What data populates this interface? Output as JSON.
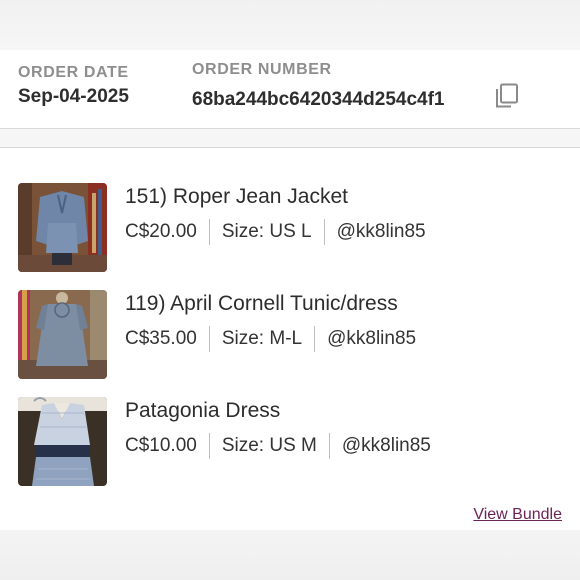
{
  "order": {
    "date_label": "ORDER DATE",
    "date_value": "Sep-04-2025",
    "number_label": "ORDER NUMBER",
    "number_value": "68ba244bc6420344d254c4f1",
    "copy_icon": "copy-icon"
  },
  "items": [
    {
      "title": "151) Roper Jean Jacket",
      "price": "C$20.00",
      "size": "Size: US L",
      "seller": "@kk8lin85",
      "thumb": "denim-jacket-photo"
    },
    {
      "title": "119) April Cornell Tunic/dress",
      "price": "C$35.00",
      "size": "Size: M-L",
      "seller": "@kk8lin85",
      "thumb": "tunic-dress-photo"
    },
    {
      "title": "Patagonia Dress",
      "price": "C$10.00",
      "size": "Size: US M",
      "seller": "@kk8lin85",
      "thumb": "patagonia-dress-photo"
    }
  ],
  "footer": {
    "view_bundle": "View Bundle"
  },
  "colors": {
    "link": "#6b2458",
    "label": "#8e8e8e",
    "text": "#2e2e2e"
  }
}
